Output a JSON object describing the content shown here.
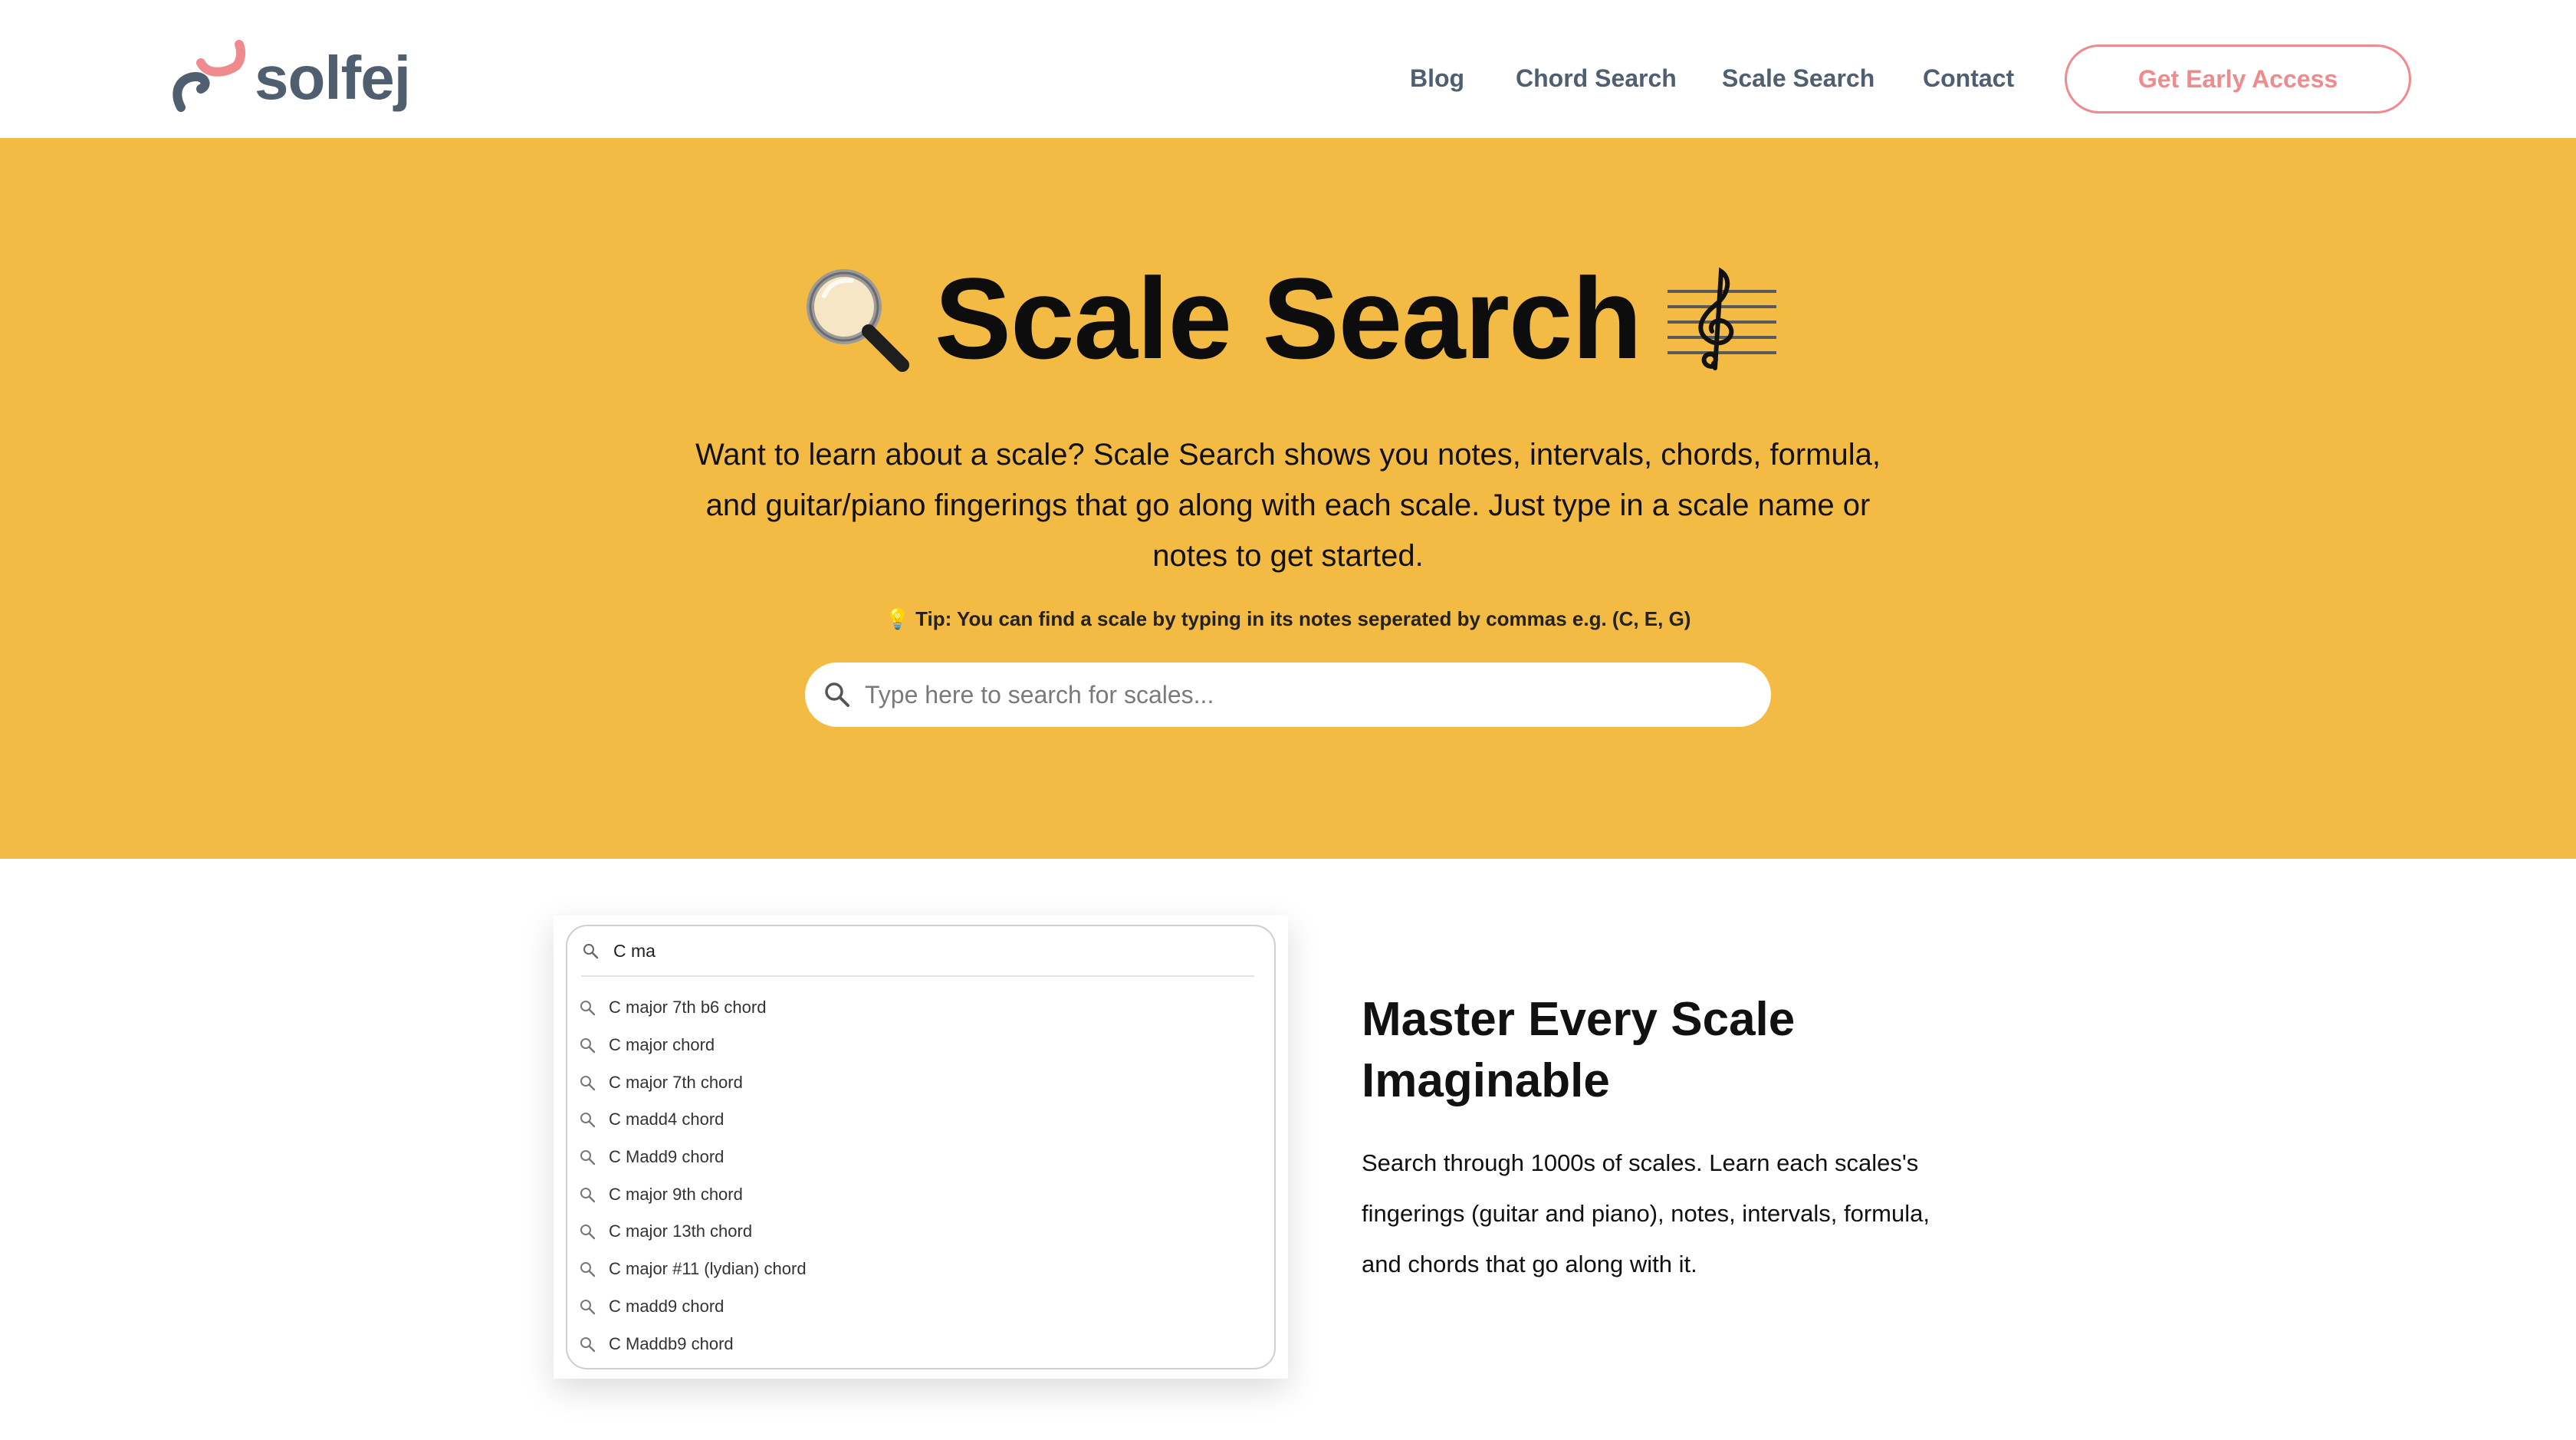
{
  "brand": {
    "name": "solfej",
    "colors": {
      "accent": "#ef8a8e",
      "slate": "#4f5f6f",
      "hero_bg": "#f3bb43"
    }
  },
  "nav": {
    "links": [
      {
        "label": "Blog",
        "icon": null
      },
      {
        "label": "Chord Search"
      },
      {
        "label": "Scale Search"
      },
      {
        "label": "Contact"
      }
    ],
    "cta_label": "Get Early Access"
  },
  "hero": {
    "title": "Scale Search",
    "title_icons": [
      "magnifying-glass-icon",
      "musical-score-icon"
    ],
    "description": "Want to learn about a scale? Scale Search shows you notes, intervals, chords, formula, and guitar/piano fingerings that go along with each scale. Just type in a scale name or notes to get started.",
    "tip": "💡 Tip: You can find a scale by typing in its notes seperated by commas e.g. (C, E, G)",
    "search_placeholder": "Type here to search for scales..."
  },
  "demo": {
    "query": "C ma",
    "results": [
      "C major 7th b6 chord",
      "C major chord",
      "C major 7th chord",
      "C madd4 chord",
      "C Madd9 chord",
      "C major 9th chord",
      "C major 13th chord",
      "C major #11 (lydian) chord",
      "C madd9 chord",
      "C Maddb9 chord"
    ]
  },
  "feature": {
    "title": "Master Every Scale Imaginable",
    "body": "Search through 1000s of scales. Learn each scales's fingerings (guitar and piano), notes, intervals, formula, and chords that go along with it."
  }
}
